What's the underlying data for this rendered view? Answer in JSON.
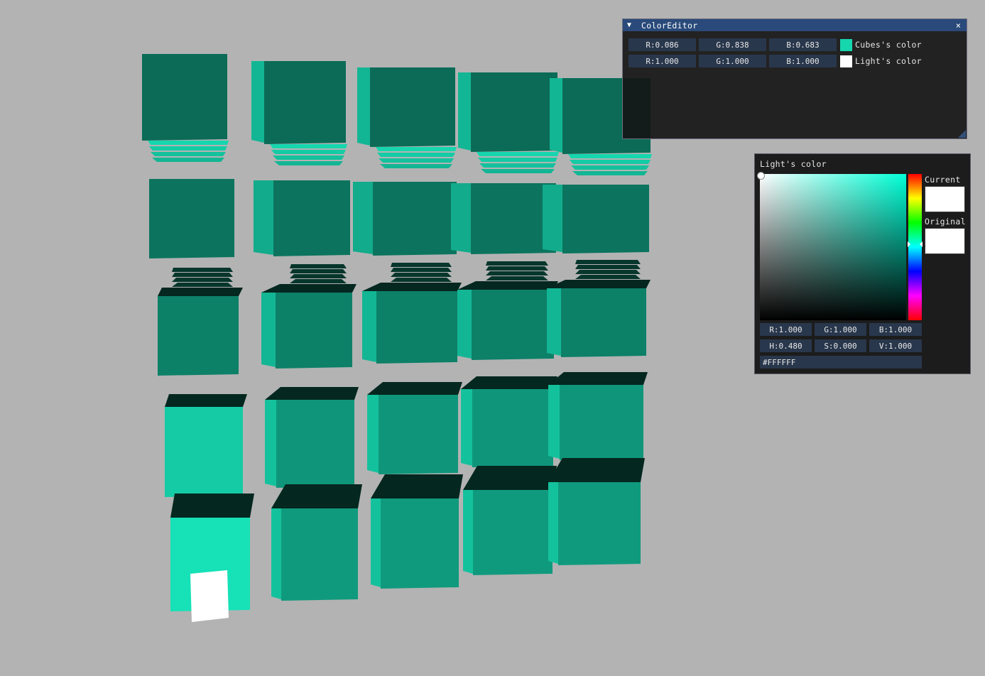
{
  "scene": {
    "background_color": "#b3b3b3",
    "cube_color": "#16d6ae",
    "light_cube_color": "#ffffff"
  },
  "color_editor": {
    "title": "ColorEditor",
    "collapse_icon": "triangle-down-icon",
    "close_icon": "close-icon",
    "close_glyph": "×",
    "collapse_glyph": "▼",
    "rows": [
      {
        "r": "R:0.086",
        "g": "G:0.838",
        "b": "B:0.683",
        "swatch_color": "#16d6ae",
        "label": "Cubes's color"
      },
      {
        "r": "R:1.000",
        "g": "G:1.000",
        "b": "B:1.000",
        "swatch_color": "#ffffff",
        "label": "Light's color"
      }
    ]
  },
  "picker": {
    "title": "Light's color",
    "current_label": "Current",
    "original_label": "Original",
    "current_color": "#ffffff",
    "original_color": "#ffffff",
    "hue_color": "#00ffd6",
    "hue_fraction": 0.48,
    "rgb": {
      "r": "R:1.000",
      "g": "G:1.000",
      "b": "B:1.000"
    },
    "hsv": {
      "h": "H:0.480",
      "s": "S:0.000",
      "v": "V:1.000"
    },
    "hex": "#FFFFFF"
  }
}
